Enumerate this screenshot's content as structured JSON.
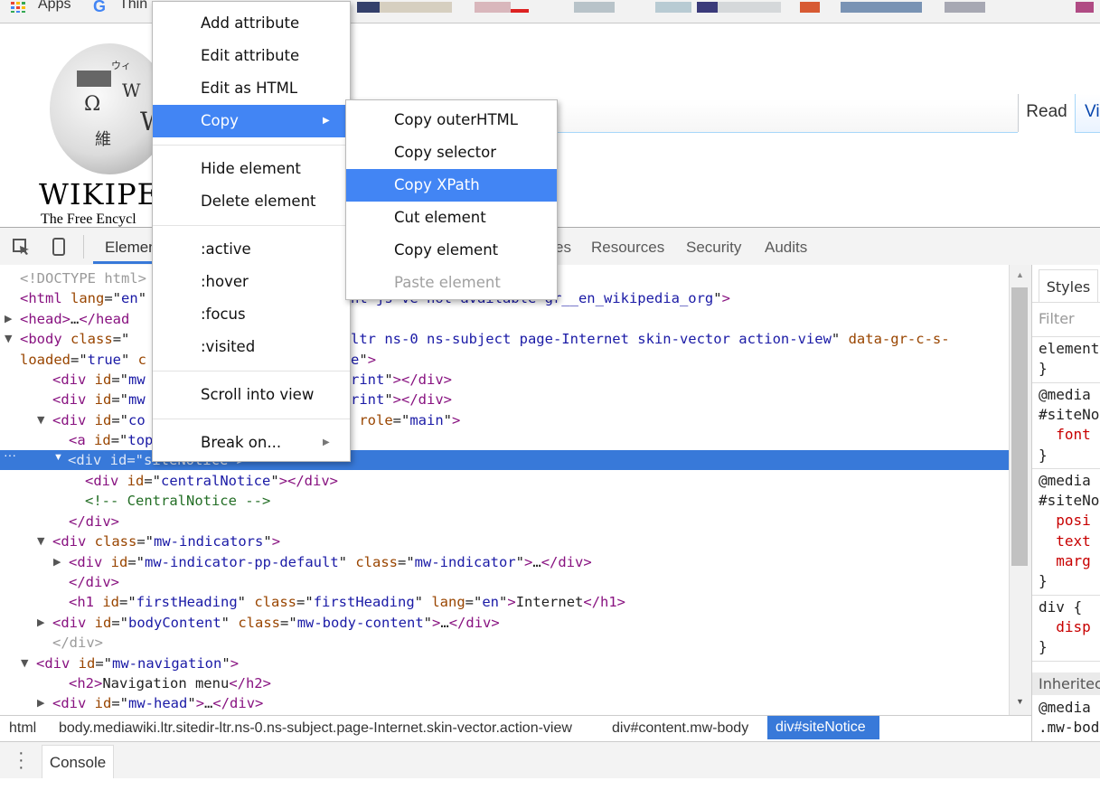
{
  "bookmarks": {
    "items": [
      {
        "label": "Apps",
        "icon": "apps-grid-icon"
      },
      {
        "label": "Thin",
        "icon": "google-icon"
      }
    ]
  },
  "page": {
    "wordmark": "Wikipedia",
    "wordmark_visible": "WIKIPEI",
    "tagline": "The Free Encyclopedia",
    "tagline_visible": "The Free Encycl",
    "tabs": [
      {
        "label": "Read",
        "active": true
      },
      {
        "label": "Vi",
        "active": false
      }
    ],
    "globe_glyphs": [
      "Ω",
      "W",
      "維",
      "W",
      "ウィ"
    ]
  },
  "devtools": {
    "toolbar": {
      "tabs": [
        "Elemen",
        "es",
        "Resources",
        "Security",
        "Audits"
      ],
      "active_tab": "Elements"
    },
    "dom_lines": [
      {
        "indent": 1,
        "html": "<span class='dim'>&lt;!DOCTYPE html&gt;</span>"
      },
      {
        "indent": 1,
        "html": "<span class='tag'>&lt;html</span> <span class='an'>lang</span>=\"<span class='av'>en</span>\""
      },
      {
        "indent": 1,
        "tri": "▶",
        "html": "<span class='tag'>&lt;head&gt;</span>…<span class='tag'>&lt;/head</span>"
      },
      {
        "indent": 1,
        "tri": "▼",
        "html": "<span class='tag'>&lt;body</span> <span class='an'>class</span>=\""
      },
      {
        "indent": 1,
        "html": "<span class='an'>loaded</span>=\"<span class='av'>true</span>\" <span class='an'>c</span>"
      },
      {
        "indent": 3,
        "html": "<span class='tag'>&lt;div</span> <span class='an'>id</span>=\"<span class='av'>mw</span>"
      },
      {
        "indent": 3,
        "html": "<span class='tag'>&lt;div</span> <span class='an'>id</span>=\"<span class='av'>mw</span>"
      },
      {
        "indent": 3,
        "tri": "▼",
        "html": "<span class='tag'>&lt;div</span> <span class='an'>id</span>=\"<span class='av'>co</span>"
      },
      {
        "indent": 4,
        "html": "<span class='tag'>&lt;a</span> <span class='an'>id</span>=\"<span class='av'>top</span>"
      },
      {
        "indent": 3,
        "tri": "▼",
        "selected": true,
        "html": "&lt;div id=\"siteNotice\"&gt;"
      },
      {
        "indent": 5,
        "html": "<span class='tag'>&lt;div</span> <span class='an'>id</span>=\"<span class='av'>centralNotice</span>\"<span class='tag'>&gt;&lt;/div&gt;</span>"
      },
      {
        "indent": 5,
        "html": "<span class='cm'>&lt;!-- CentralNotice --&gt;</span>"
      },
      {
        "indent": 4,
        "html": "<span class='tag'>&lt;/div&gt;</span>"
      },
      {
        "indent": 3,
        "tri": "▼",
        "html": "<span class='tag'>&lt;div</span> <span class='an'>class</span>=\"<span class='av'>mw-indicators</span>\"<span class='tag'>&gt;</span>"
      },
      {
        "indent": 4,
        "tri": "▶",
        "html": "<span class='tag'>&lt;div</span> <span class='an'>id</span>=\"<span class='av'>mw-indicator-pp-default</span>\" <span class='an'>class</span>=\"<span class='av'>mw-indicator</span>\"<span class='tag'>&gt;</span>…<span class='tag'>&lt;/div&gt;</span>"
      },
      {
        "indent": 4,
        "html": "<span class='tag'>&lt;/div&gt;</span>"
      },
      {
        "indent": 4,
        "html": "<span class='tag'>&lt;h1</span> <span class='an'>id</span>=\"<span class='av'>firstHeading</span>\" <span class='an'>class</span>=\"<span class='av'>firstHeading</span>\" <span class='an'>lang</span>=\"<span class='av'>en</span>\"<span class='tag'>&gt;</span>Internet<span class='tag'>&lt;/h1&gt;</span>"
      },
      {
        "indent": 3,
        "tri": "▶",
        "html": "<span class='tag'>&lt;div</span> <span class='an'>id</span>=\"<span class='av'>bodyContent</span>\" <span class='an'>class</span>=\"<span class='av'>mw-body-content</span>\"<span class='tag'>&gt;</span>…<span class='tag'>&lt;/div&gt;</span>"
      },
      {
        "indent": 3,
        "html": "<span class='dim'>&lt;/div&gt;</span>"
      },
      {
        "indent": 2,
        "tri": "▼",
        "html": "<span class='tag'>&lt;div</span> <span class='an'>id</span>=\"<span class='av'>mw-navigation</span>\"<span class='tag'>&gt;</span>"
      },
      {
        "indent": 4,
        "html": "<span class='tag'>&lt;h2&gt;</span>Navigation menu<span class='tag'>&lt;/h2&gt;</span>"
      },
      {
        "indent": 3,
        "tri": "▶",
        "html": "<span class='tag'>&lt;div</span> <span class='an'>id</span>=\"<span class='av'>mw-head</span>\"<span class='tag'>&gt;</span>…<span class='tag'>&lt;/div&gt;</span>"
      }
    ],
    "dom_right_fragments": [
      {
        "row": 1,
        "html": "<span class='av'>nt-js-ve-not-available gr__en_wikipedia_org</span>\"<span class='tag'>&gt;</span>"
      },
      {
        "row": 3,
        "html": "<span class='av'>ltr ns-0 ns-subject page-Internet skin-vector action-view</span>\" <span class='an'>data-gr-c-s-</span>"
      },
      {
        "row": 4,
        "html": "<span class='av'>e</span>\"<span class='tag'>&gt;</span>"
      },
      {
        "row": 5,
        "html": "<span class='av'>rint</span>\"<span class='tag'>&gt;&lt;/div&gt;</span>"
      },
      {
        "row": 6,
        "html": "<span class='av'>rint</span>\"<span class='tag'>&gt;&lt;/div&gt;</span>"
      },
      {
        "row": 7,
        "html": " <span class='an'>role</span>=\"<span class='av'>main</span>\"<span class='tag'>&gt;</span>"
      }
    ],
    "selected_node": "<div id=\"siteNotice\">",
    "row_gutter_dots": "···",
    "styles_pane": {
      "tab_label": "Styles",
      "filter_placeholder": "Filter",
      "blocks": [
        {
          "lines": [
            "element",
            "}"
          ]
        },
        {
          "lines": [
            "@media",
            "#siteNo",
            "  font",
            "}"
          ]
        },
        {
          "lines": [
            "@media",
            "#siteNo",
            "  posi",
            "  text",
            "  marg",
            "}"
          ]
        },
        {
          "lines": [
            "div {",
            "  disp",
            "}"
          ]
        }
      ],
      "inherited_label": "Inheritec",
      "inherited_lines": [
        "@media",
        ".mw-bod"
      ]
    },
    "breadcrumb": [
      "html",
      "body.mediawiki.ltr.sitedir-ltr.ns-0.ns-subject.page-Internet.skin-vector.action-view",
      "div#content.mw-body",
      "div#siteNotice"
    ],
    "drawer": {
      "menu_icon": "vertical-dots-icon",
      "tabs": [
        "Console"
      ]
    }
  },
  "context_menu": {
    "items": [
      {
        "label": "Add attribute"
      },
      {
        "label": "Edit attribute"
      },
      {
        "label": "Edit as HTML"
      },
      {
        "label": "Copy",
        "submenu": true,
        "highlighted": true
      },
      {
        "separator": true
      },
      {
        "label": "Hide element"
      },
      {
        "label": "Delete element"
      },
      {
        "separator": true
      },
      {
        "label": ":active"
      },
      {
        "label": ":hover"
      },
      {
        "label": ":focus"
      },
      {
        "label": ":visited"
      },
      {
        "separator": true
      },
      {
        "label": "Scroll into view"
      },
      {
        "separator": true
      },
      {
        "label": "Break on...",
        "submenu": true
      }
    ],
    "copy_submenu": [
      {
        "label": "Copy outerHTML"
      },
      {
        "label": "Copy selector"
      },
      {
        "label": "Copy XPath",
        "highlighted": true
      },
      {
        "label": "Cut element"
      },
      {
        "label": "Copy element"
      },
      {
        "label": "Paste element",
        "disabled": true
      }
    ]
  },
  "colors": {
    "accent": "#4285f4",
    "selection": "#3879d9",
    "tag": "#881280",
    "attr_name": "#994500",
    "attr_value": "#1a1aa6",
    "comment": "#236e25"
  }
}
